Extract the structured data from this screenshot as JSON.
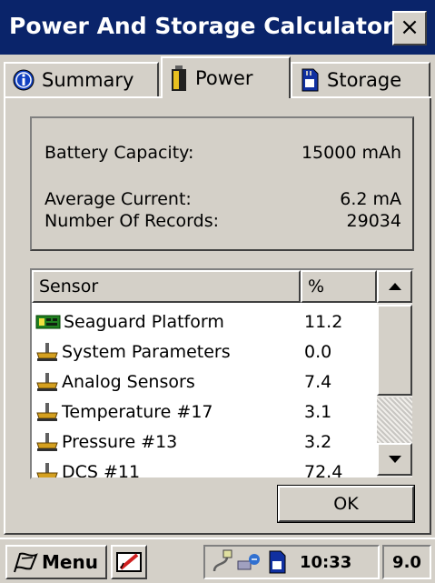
{
  "window": {
    "title": "Power And Storage Calculator",
    "close_label": "×"
  },
  "tabs": [
    {
      "label": "Summary",
      "icon": "info-icon",
      "active": false
    },
    {
      "label": "Power",
      "icon": "battery-icon",
      "active": true
    },
    {
      "label": "Storage",
      "icon": "sd-card-icon",
      "active": false
    }
  ],
  "summary": {
    "battery_capacity_label": "Battery Capacity:",
    "battery_capacity_value": "15000 mAh",
    "average_current_label": "Average Current:",
    "average_current_value": "6.2 mA",
    "records_label": "Number Of Records:",
    "records_value": "29034"
  },
  "table": {
    "columns": [
      "Sensor",
      "%"
    ],
    "rows": [
      {
        "sensor": "Seaguard Platform",
        "percent": "11.2",
        "icon": "platform-board-icon"
      },
      {
        "sensor": "System Parameters",
        "percent": "0.0",
        "icon": "sensor-probe-icon"
      },
      {
        "sensor": "Analog Sensors",
        "percent": "7.4",
        "icon": "sensor-probe-icon"
      },
      {
        "sensor": "Temperature #17",
        "percent": "3.1",
        "icon": "sensor-probe-icon"
      },
      {
        "sensor": "Pressure #13",
        "percent": "3.2",
        "icon": "sensor-probe-icon"
      },
      {
        "sensor": "DCS #11",
        "percent": "72.4",
        "icon": "sensor-probe-icon"
      }
    ]
  },
  "ok_label": "OK",
  "taskbar": {
    "menu_label": "Menu",
    "time": "10:33",
    "version": "9.0"
  },
  "colors": {
    "titlebar": "#0a246a",
    "face": "#d4d0c8",
    "list_bg": "#ffffff"
  }
}
